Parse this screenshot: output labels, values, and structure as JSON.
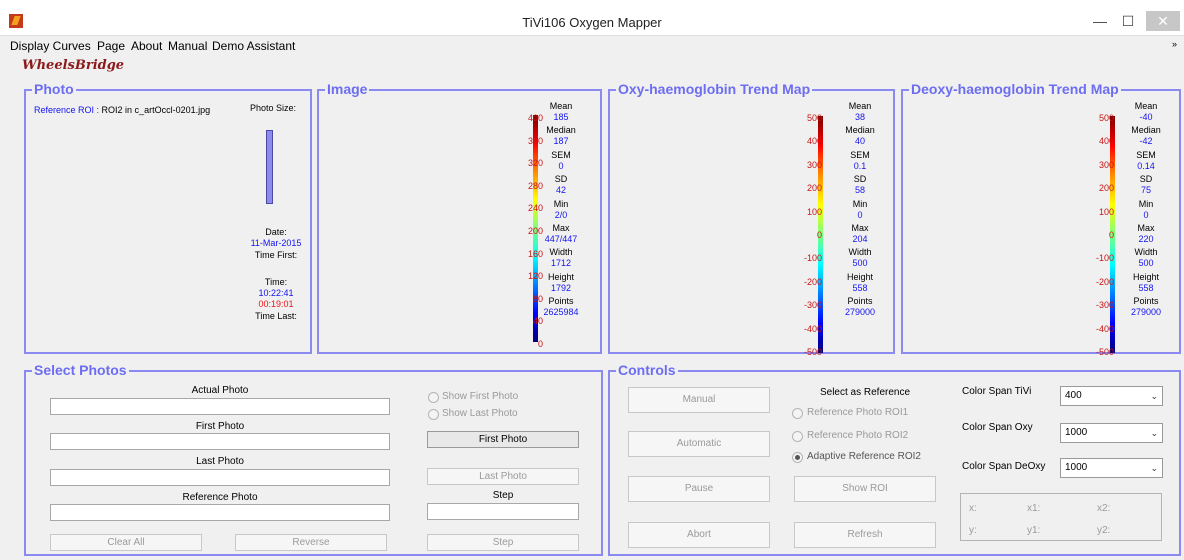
{
  "window": {
    "title": "TiVi106 Oxygen Mapper",
    "minimize": "—",
    "maximize": "☐",
    "close": "✕"
  },
  "menu": [
    "Display Curves",
    "Page",
    "About",
    "Manual",
    "Demo Assistant"
  ],
  "logo_text": "WheelsBridge",
  "photo_panel": {
    "title": "Photo",
    "ref_label": "Reference ROI :",
    "ref_value": "ROI2 in c_artOccl-0201.jpg",
    "photo_size_label": "Photo Size:",
    "date_label": "Date:",
    "date_value": "11-Mar-2015",
    "time_first_label": "Time First:",
    "time_label": "Time:",
    "time_value": "10:22:41",
    "elapsed_value": "00:19:01",
    "time_last_label": "Time Last:"
  },
  "image_panel": {
    "title": "Image",
    "ticks": [
      "400",
      "360",
      "320",
      "280",
      "240",
      "200",
      "160",
      "120",
      "80",
      "40",
      "0"
    ],
    "stats": [
      {
        "label": "Mean",
        "value": "185"
      },
      {
        "label": "Median",
        "value": "187"
      },
      {
        "label": "SEM",
        "value": "0"
      },
      {
        "label": "SD",
        "value": "42"
      },
      {
        "label": "Min",
        "value": "2/0"
      },
      {
        "label": "Max",
        "value": "447/447"
      },
      {
        "label": "Width",
        "value": "1712"
      },
      {
        "label": "Height",
        "value": "1792"
      },
      {
        "label": "Points",
        "value": "2625984"
      }
    ]
  },
  "oxy_panel": {
    "title": "Oxy-haemoglobin Trend Map",
    "ticks": [
      "500",
      "400",
      "300",
      "200",
      "100",
      "0",
      "-100",
      "-200",
      "-300",
      "-400",
      "-500"
    ],
    "stats": [
      {
        "label": "Mean",
        "value": "38"
      },
      {
        "label": "Median",
        "value": "40"
      },
      {
        "label": "SEM",
        "value": "0.1"
      },
      {
        "label": "SD",
        "value": "58"
      },
      {
        "label": "Min",
        "value": "0"
      },
      {
        "label": "Max",
        "value": "204"
      },
      {
        "label": "Width",
        "value": "500"
      },
      {
        "label": "Height",
        "value": "558"
      },
      {
        "label": "Points",
        "value": "279000"
      }
    ]
  },
  "deoxy_panel": {
    "title": "Deoxy-haemoglobin Trend Map",
    "ticks": [
      "500",
      "400",
      "300",
      "200",
      "100",
      "0",
      "-100",
      "-200",
      "-300",
      "-400",
      "-500"
    ],
    "stats": [
      {
        "label": "Mean",
        "value": "-40"
      },
      {
        "label": "Median",
        "value": "-42"
      },
      {
        "label": "SEM",
        "value": "0.14"
      },
      {
        "label": "SD",
        "value": "75"
      },
      {
        "label": "Min",
        "value": "0"
      },
      {
        "label": "Max",
        "value": "220"
      },
      {
        "label": "Width",
        "value": "500"
      },
      {
        "label": "Height",
        "value": "558"
      },
      {
        "label": "Points",
        "value": "279000"
      }
    ]
  },
  "select_panel": {
    "title": "Select Photos",
    "actual_label": "Actual Photo",
    "actual_value": "",
    "first_label": "First Photo",
    "first_value": "",
    "last_label": "Last Photo",
    "last_value": "",
    "reference_label": "Reference Photo",
    "reference_value": "",
    "show_first": "Show First Photo",
    "show_last": "Show Last Photo",
    "first_button": "First Photo",
    "last_button": "Last Photo",
    "step_label": "Step",
    "step_value": "",
    "clear_button": "Clear All",
    "reverse_button": "Reverse",
    "step_button": "Step"
  },
  "controls_panel": {
    "title": "Controls",
    "manual": "Manual",
    "automatic": "Automatic",
    "pause": "Pause",
    "abort": "Abort",
    "select_ref_label": "Select as Reference",
    "ref_roi1": "Reference Photo ROI1",
    "ref_roi2": "Reference Photo ROI2",
    "adaptive": "Adaptive Reference ROI2",
    "show_roi": "Show ROI",
    "refresh": "Refresh",
    "span_tivi_label": "Color Span TiVi",
    "span_tivi_value": "400",
    "span_oxy_label": "Color Span Oxy",
    "span_oxy_value": "1000",
    "span_deoxy_label": "Color Span DeOxy",
    "span_deoxy_value": "1000",
    "coords": {
      "x": "x:",
      "x1": "x1:",
      "x2": "x2:",
      "y": "y:",
      "y1": "y1:",
      "y2": "y2:"
    }
  }
}
